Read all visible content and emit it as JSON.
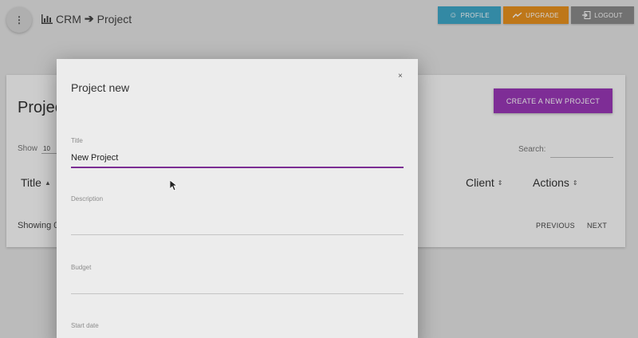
{
  "topbar": {
    "crumb_root": "CRM",
    "crumb_current": "Project",
    "buttons": {
      "profile": "PROFILE",
      "upgrade": "UPGRADE",
      "logout": "LOGOUT"
    }
  },
  "card": {
    "title": "Projec",
    "create_label": "CREATE A NEW PROJECT",
    "show_label": "Show",
    "show_value": "10",
    "search_label": "Search:",
    "columns": {
      "title": "Title",
      "client": "Client",
      "actions": "Actions"
    },
    "showing_text": "Showing 0",
    "previous": "PREVIOUS",
    "next": "NEXT"
  },
  "modal": {
    "title": "Project new",
    "close_glyph": "×",
    "fields": {
      "title": {
        "label": "Title",
        "value": "New Project"
      },
      "description": {
        "label": "Description",
        "value": ""
      },
      "budget": {
        "label": "Budget",
        "value": ""
      },
      "start_date": {
        "label": "Start date",
        "value": ""
      }
    }
  },
  "colors": {
    "profile": "#3fa8c8",
    "upgrade": "#e8921f",
    "logout": "#8a8a8a",
    "create": "#9a38b8",
    "field_active": "#7b2d93"
  },
  "icons": [
    "more-vertical-icon",
    "bar-chart-icon",
    "arrow-right-icon",
    "face-icon",
    "trending-up-icon",
    "logout-icon",
    "sort-icon",
    "close-icon",
    "mouse-pointer-icon"
  ]
}
